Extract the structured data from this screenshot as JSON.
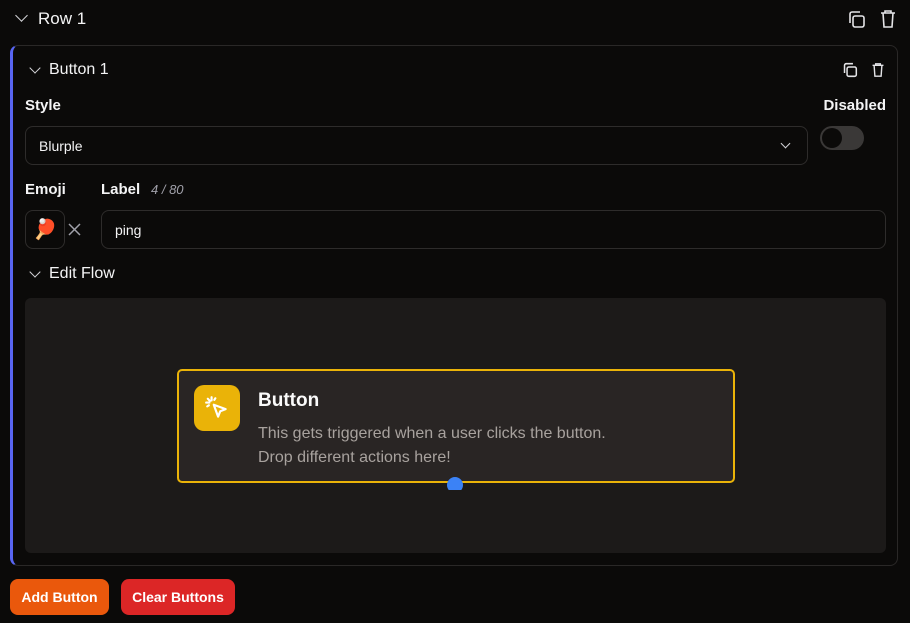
{
  "row": {
    "title": "Row 1"
  },
  "button": {
    "title": "Button 1",
    "style_label": "Style",
    "style_value": "Blurple",
    "disabled_label": "Disabled",
    "disabled": false,
    "emoji_label": "Emoji",
    "emoji": "🏓",
    "label_label": "Label",
    "label_count": "4 / 80",
    "label_value": "ping",
    "edit_flow": "Edit Flow"
  },
  "flow": {
    "node_title": "Button",
    "node_desc_1": "This gets triggered when a user clicks the button.",
    "node_desc_2": "Drop different actions here!"
  },
  "actions": {
    "add": "Add Button",
    "clear": "Clear Buttons"
  },
  "colors": {
    "accent": "#5865f2",
    "node_border": "#eab308",
    "add": "#ea580c",
    "clear": "#dc2626",
    "handle": "#3b82f6"
  }
}
